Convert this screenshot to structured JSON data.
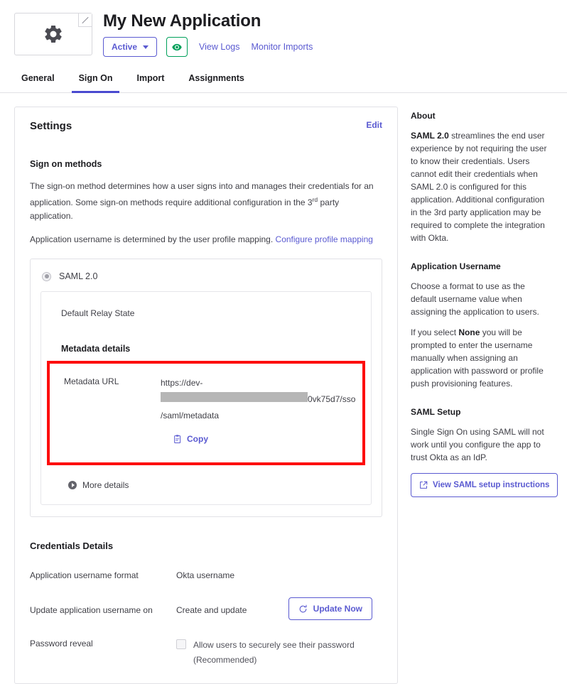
{
  "header": {
    "app_title": "My New Application",
    "logo_icon": "gear-icon",
    "logo_edit_icon": "edit-pencil-corner-icon",
    "status_label": "Active",
    "status_caret_icon": "chevron-down-icon",
    "preview_icon": "okta-eye-icon",
    "links": [
      {
        "label": "View Logs"
      },
      {
        "label": "Monitor Imports"
      }
    ],
    "accent_blue": "#5a5ad1",
    "accent_green": "#00a05a"
  },
  "tabs": [
    {
      "label": "General",
      "active": false
    },
    {
      "label": "Sign On",
      "active": true
    },
    {
      "label": "Import",
      "active": false
    },
    {
      "label": "Assignments",
      "active": false
    }
  ],
  "settings": {
    "title": "Settings",
    "edit_label": "Edit",
    "sign_on_methods": {
      "heading": "Sign on methods",
      "description_part1": "The sign-on method determines how a user signs into and manages their credentials for an application. Some sign-on methods require additional configuration in the 3",
      "description_ordinal": "rd",
      "description_part2": " party application.",
      "username_sentence": "Application username is determined by the user profile mapping.",
      "configure_link": "Configure profile mapping"
    },
    "method": {
      "name": "SAML 2.0",
      "selected": true,
      "default_relay_state_label": "Default Relay State",
      "default_relay_state_value": "",
      "metadata_heading": "Metadata details",
      "metadata_url_label": "Metadata URL",
      "metadata_url_line1": "https://dev-",
      "metadata_url_line2_suffix": "0vk75d7/sso",
      "metadata_url_line3": "/saml/metadata",
      "metadata_url_redacted": true,
      "copy_label": "Copy",
      "copy_icon": "clipboard-icon",
      "more_details_label": "More details",
      "more_details_icon": "chevron-right-circle-icon",
      "highlight_color": "#fd0d0d"
    }
  },
  "credentials": {
    "title": "Credentials Details",
    "rows": [
      {
        "label": "Application username format",
        "value": "Okta username"
      },
      {
        "label": "Update application username on",
        "value": "Create and update"
      }
    ],
    "update_now_label": "Update Now",
    "update_now_icon": "refresh-icon",
    "password_reveal_label": "Password reveal",
    "password_reveal_checkbox_checked": false,
    "password_reveal_text_line1": "Allow users to securely see their password",
    "password_reveal_text_line2": "(Recommended)"
  },
  "about": {
    "title": "About",
    "saml_bold": "SAML 2.0",
    "saml_text": " streamlines the end user experience by not requiring the user to know their credentials. Users cannot edit their credentials when SAML 2.0 is configured for this application. Additional configuration in the 3rd party application may be required to complete the integration with Okta.",
    "app_username_heading": "Application Username",
    "app_username_text": "Choose a format to use as the default username value when assigning the application to users.",
    "none_prefix": "If you select ",
    "none_bold": "None",
    "none_suffix": " you will be prompted to enter the username manually when assigning an application with password or profile push provisioning features.",
    "saml_setup_heading": "SAML Setup",
    "saml_setup_text": "Single Sign On using SAML will not work until you configure the app to trust Okta as an IdP.",
    "saml_setup_button_label": "View SAML setup instructions",
    "saml_setup_button_icon": "external-link-icon"
  }
}
